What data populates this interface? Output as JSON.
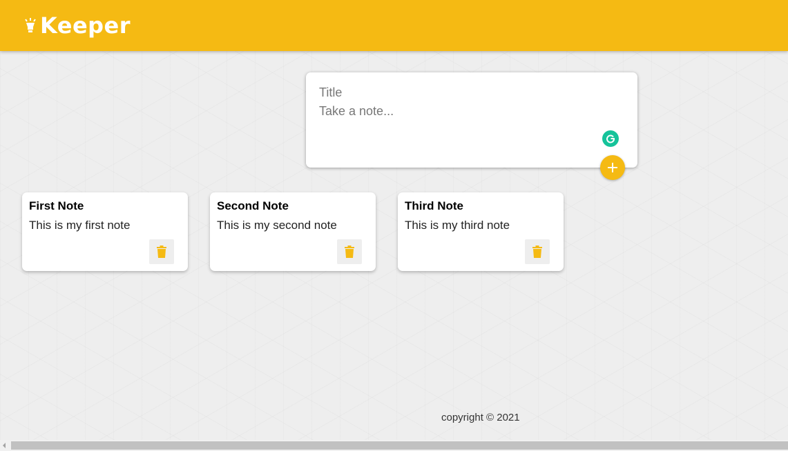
{
  "header": {
    "brand": "Keeper",
    "logo_icon": "bulb-icon"
  },
  "create_note": {
    "title_placeholder": "Title",
    "content_placeholder": "Take a note...",
    "title_value": "",
    "content_value": "",
    "add_icon": "plus-icon"
  },
  "notes": [
    {
      "title": "First Note",
      "content": "This is my first note"
    },
    {
      "title": "Second Note",
      "content": "This is my second note"
    },
    {
      "title": "Third Note",
      "content": "This is my third note"
    }
  ],
  "footer": {
    "copyright": "copyright © 2021"
  },
  "colors": {
    "accent": "#f5ba13",
    "grammarly": "#15c39a",
    "background": "#eeeeee"
  }
}
